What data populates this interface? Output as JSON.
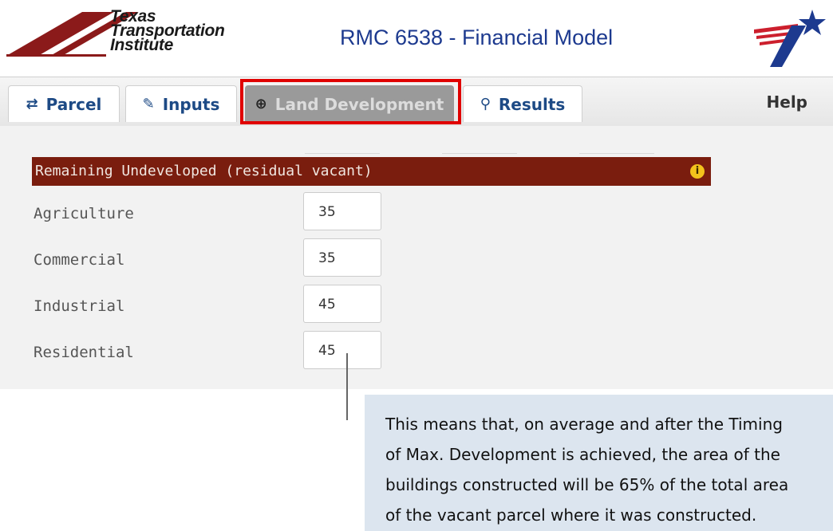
{
  "header": {
    "org_line1": "Texas",
    "org_line2": "Transportation",
    "org_line3": "Institute",
    "title": "RMC 6538 - Financial Model"
  },
  "tabs": [
    {
      "label": "Parcel",
      "icon": "arrows-icon"
    },
    {
      "label": "Inputs",
      "icon": "pencil-icon"
    },
    {
      "label": "Land Development",
      "icon": "circle-plus-icon",
      "active": true
    },
    {
      "label": "Results",
      "icon": "map-pin-icon"
    }
  ],
  "help_label": "Help",
  "section": {
    "title": "Remaining Undeveloped (residual vacant)",
    "info_icon": "i"
  },
  "fields": [
    {
      "label": "Agriculture",
      "value": "35"
    },
    {
      "label": "Commercial",
      "value": "35"
    },
    {
      "label": "Industrial",
      "value": "45"
    },
    {
      "label": "Residential",
      "value": "45"
    }
  ],
  "callout": {
    "line1": "This means that, on average and after the Timing",
    "line2": "of Max. Development is achieved, the area of the",
    "line3": "buildings constructed will be 65% of the total area",
    "line4": "of the vacant parcel where it was constructed."
  },
  "colors": {
    "section_bar": "#7a1d0e",
    "title_blue": "#1d3a8f",
    "highlight": "#e00000",
    "callout_bg": "#dce5ef"
  }
}
